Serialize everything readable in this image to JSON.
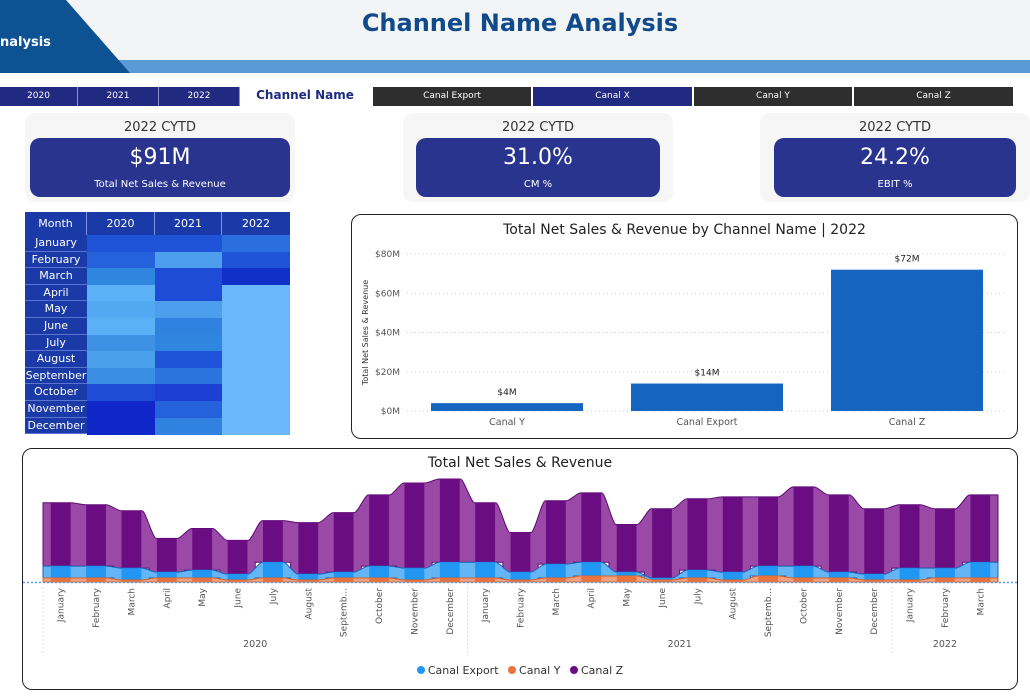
{
  "header": {
    "tab_label": "nalysis",
    "title": "Channel Name Analysis"
  },
  "slicers": {
    "years": [
      "2020",
      "2021",
      "2022"
    ],
    "channel_label": "Channel Name",
    "channels": [
      "Canal Export",
      "Canal X",
      "Canal Y",
      "Canal Z"
    ],
    "active_channel": "Canal X"
  },
  "kpis": [
    {
      "heading": "2022 CYTD",
      "value": "$91M",
      "label": "Total Net Sales & Revenue"
    },
    {
      "heading": "2022 CYTD",
      "value": "31.0%",
      "label": "CM %"
    },
    {
      "heading": "2022 CYTD",
      "value": "24.2%",
      "label": "EBIT %"
    }
  ],
  "matrix": {
    "header": [
      "Month",
      "2020",
      "2021",
      "2022"
    ],
    "months": [
      "January",
      "February",
      "March",
      "April",
      "May",
      "June",
      "July",
      "August",
      "September",
      "October",
      "November",
      "December"
    ],
    "colors_2020": [
      "#1f54d9",
      "#2561da",
      "#2f86df",
      "#5cb0f5",
      "#53a8f2",
      "#5cb0f5",
      "#3e91e5",
      "#4ba0ec",
      "#3a8ee3",
      "#1f4cd6",
      "#0f27c8",
      "#0f27c8"
    ],
    "colors_2021": [
      "#1f54d9",
      "#4d9fee",
      "#1f4cd6",
      "#1f4cd6",
      "#4d9fee",
      "#3182e0",
      "#2f86df",
      "#1f54d9",
      "#2a74dd",
      "#1c40d2",
      "#2561da",
      "#3182e0"
    ],
    "colors_2022": [
      "#2a6fdd",
      "#1f54d9",
      "#1030c8",
      "#6ab8fb",
      "#6ab8fb",
      "#6ab8fb",
      "#6ab8fb",
      "#6ab8fb",
      "#6ab8fb",
      "#6ab8fb",
      "#6ab8fb",
      "#6ab8fb"
    ]
  },
  "chart_data": [
    {
      "type": "bar",
      "title": "Total Net Sales & Revenue by Channel Name | 2022",
      "ylabel": "Total Net Sales & Revenue",
      "categories": [
        "Canal Y",
        "Canal Export",
        "Canal Z"
      ],
      "values": [
        4,
        14,
        72
      ],
      "data_labels": [
        "$4M",
        "$14M",
        "$72M"
      ],
      "yticks": [
        "$0M",
        "$20M",
        "$40M",
        "$60M",
        "$80M"
      ],
      "ylim": [
        0,
        80
      ],
      "color": "#1565c0",
      "grid": true
    },
    {
      "type": "area",
      "title": "Total Net Sales & Revenue",
      "x": [
        "January",
        "February",
        "March",
        "April",
        "May",
        "June",
        "July",
        "August",
        "Septemb...",
        "October",
        "November",
        "December",
        "January",
        "February",
        "March",
        "April",
        "May",
        "June",
        "July",
        "August",
        "Septemb...",
        "October",
        "November",
        "December",
        "January",
        "February",
        "March"
      ],
      "x_groups": [
        {
          "label": "2020",
          "count": 12
        },
        {
          "label": "2021",
          "count": 12
        },
        {
          "label": "2022",
          "count": 3
        }
      ],
      "series": [
        {
          "name": "Canal Export",
          "color": "#2196f3",
          "values": [
            6,
            6,
            6,
            3,
            4,
            3,
            8,
            3,
            3,
            6,
            6,
            8,
            8,
            4,
            7,
            7,
            2,
            1,
            4,
            4,
            5,
            6,
            3,
            3,
            6,
            5,
            8
          ]
        },
        {
          "name": "Canal Y",
          "color": "#e8733d",
          "values": [
            2,
            2,
            1,
            2,
            2,
            1,
            2,
            1,
            2,
            2,
            1,
            2,
            2,
            1,
            2,
            3,
            3,
            1,
            2,
            1,
            3,
            2,
            2,
            1,
            1,
            2,
            2
          ]
        },
        {
          "name": "Canal Z",
          "color": "#6a0d83",
          "values": [
            32,
            31,
            29,
            17,
            21,
            17,
            21,
            26,
            30,
            36,
            43,
            42,
            30,
            20,
            32,
            35,
            24,
            35,
            36,
            38,
            35,
            40,
            39,
            33,
            32,
            30,
            34
          ]
        }
      ],
      "legend": "bottom"
    }
  ]
}
